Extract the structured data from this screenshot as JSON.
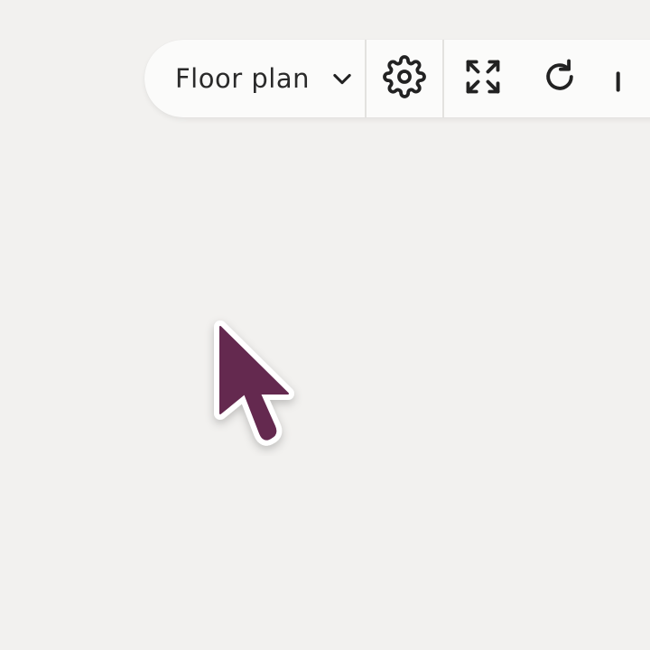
{
  "toolbar": {
    "view_select": {
      "label": "Floor plan",
      "icon": "chevron-down-icon"
    },
    "buttons": [
      {
        "name": "settings",
        "icon": "gear-icon"
      },
      {
        "name": "fullscreen",
        "icon": "expand-icon"
      },
      {
        "name": "refresh",
        "icon": "refresh-icon"
      },
      {
        "name": "more",
        "icon": "partially-visible-icon"
      }
    ]
  },
  "cursor": {
    "icon": "pointer-cursor-icon",
    "color": "#64294f"
  },
  "colors": {
    "background": "#f2f1ef",
    "toolbar": "#fbfbfa",
    "icon": "#222222"
  }
}
